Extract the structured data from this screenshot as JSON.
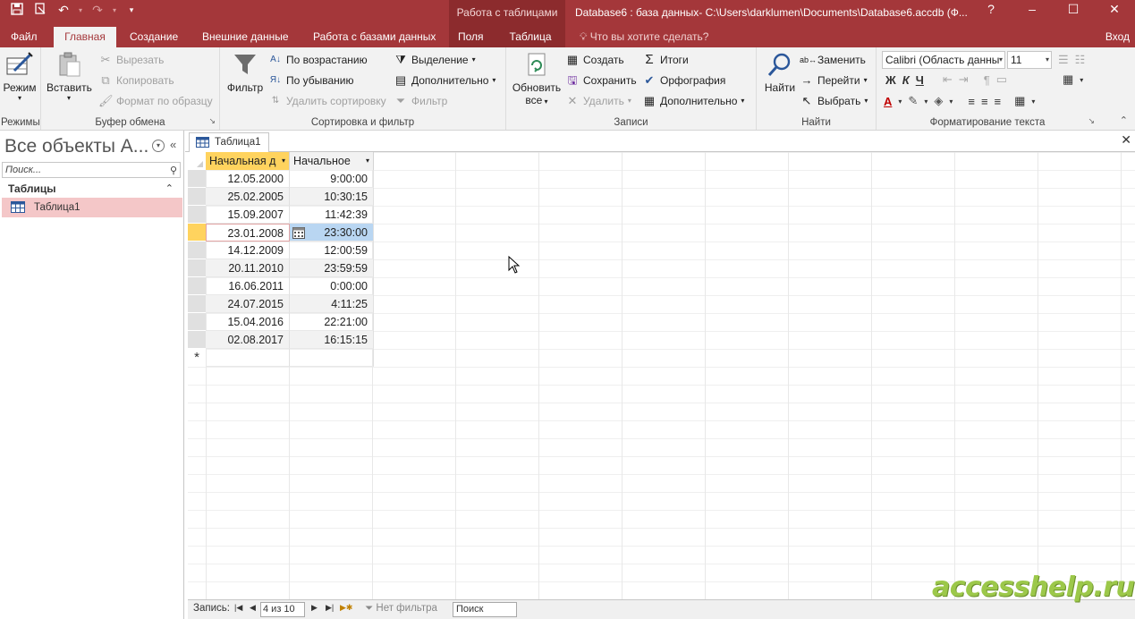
{
  "qat": {
    "save_icon": "save-icon",
    "touch_icon": "touch-mode-icon",
    "undo_icon": "undo-icon",
    "redo_icon": "redo-icon",
    "customize_icon": "customize-qat-icon"
  },
  "title": {
    "context": "Работа с таблицами",
    "document": "Database6 : база данных- C:\\Users\\darklumen\\Documents\\Database6.accdb (Ф..."
  },
  "window": {
    "help": "?",
    "minimize": "–",
    "maximize": "☐",
    "close": "✕"
  },
  "tabs": [
    {
      "label": "Файл"
    },
    {
      "label": "Главная"
    },
    {
      "label": "Создание"
    },
    {
      "label": "Внешние данные"
    },
    {
      "label": "Работа с базами данных"
    },
    {
      "label": "Поля"
    },
    {
      "label": "Таблица"
    }
  ],
  "tell_me": "Что вы хотите сделать?",
  "sign_in": "Вход",
  "ribbon": {
    "views": {
      "label": "Режимы",
      "view_btn": "Режим"
    },
    "clipboard": {
      "label": "Буфер обмена",
      "paste": "Вставить",
      "cut": "Вырезать",
      "copy": "Копировать",
      "format_painter": "Формат по образцу"
    },
    "sort": {
      "label": "Сортировка и фильтр",
      "filter": "Фильтр",
      "asc": "По возрастанию",
      "desc": "По убыванию",
      "remove_sort": "Удалить сортировку",
      "selection": "Выделение",
      "advanced": "Дополнительно",
      "toggle_filter": "Фильтр"
    },
    "records": {
      "label": "Записи",
      "refresh": "Обновить",
      "refresh2": "все",
      "new": "Создать",
      "save": "Сохранить",
      "delete": "Удалить",
      "totals": "Итоги",
      "spelling": "Орфография",
      "more": "Дополнительно"
    },
    "find": {
      "label": "Найти",
      "find": "Найти",
      "replace": "Заменить",
      "goto": "Перейти",
      "select": "Выбрать"
    },
    "text": {
      "label": "Форматирование текста",
      "font": "Calibri (Область данны",
      "size": "11",
      "bold": "Ж",
      "italic": "К",
      "underline": "Ч"
    }
  },
  "nav": {
    "title": "Все объекты A...",
    "search_placeholder": "Поиск...",
    "section": "Таблицы",
    "items": [
      {
        "label": "Таблица1"
      }
    ]
  },
  "doc": {
    "tab": "Таблица1"
  },
  "table": {
    "columns": [
      {
        "label": "Начальная д"
      },
      {
        "label": "Начальное"
      }
    ],
    "rows": [
      [
        "12.05.2000",
        "9:00:00"
      ],
      [
        "25.02.2005",
        "10:30:15"
      ],
      [
        "15.09.2007",
        "11:42:39"
      ],
      [
        "23.01.2008",
        "23:30:00"
      ],
      [
        "14.12.2009",
        "12:00:59"
      ],
      [
        "20.11.2010",
        "23:59:59"
      ],
      [
        "16.06.2011",
        "0:00:00"
      ],
      [
        "24.07.2015",
        "4:11:25"
      ],
      [
        "15.04.2016",
        "22:21:00"
      ],
      [
        "02.08.2017",
        "16:15:15"
      ]
    ],
    "new_row_marker": "*"
  },
  "recnav": {
    "label": "Запись:",
    "position": "4 из 10",
    "filter": "Нет фильтра",
    "search": "Поиск"
  },
  "watermark": "accesshelp.ru"
}
